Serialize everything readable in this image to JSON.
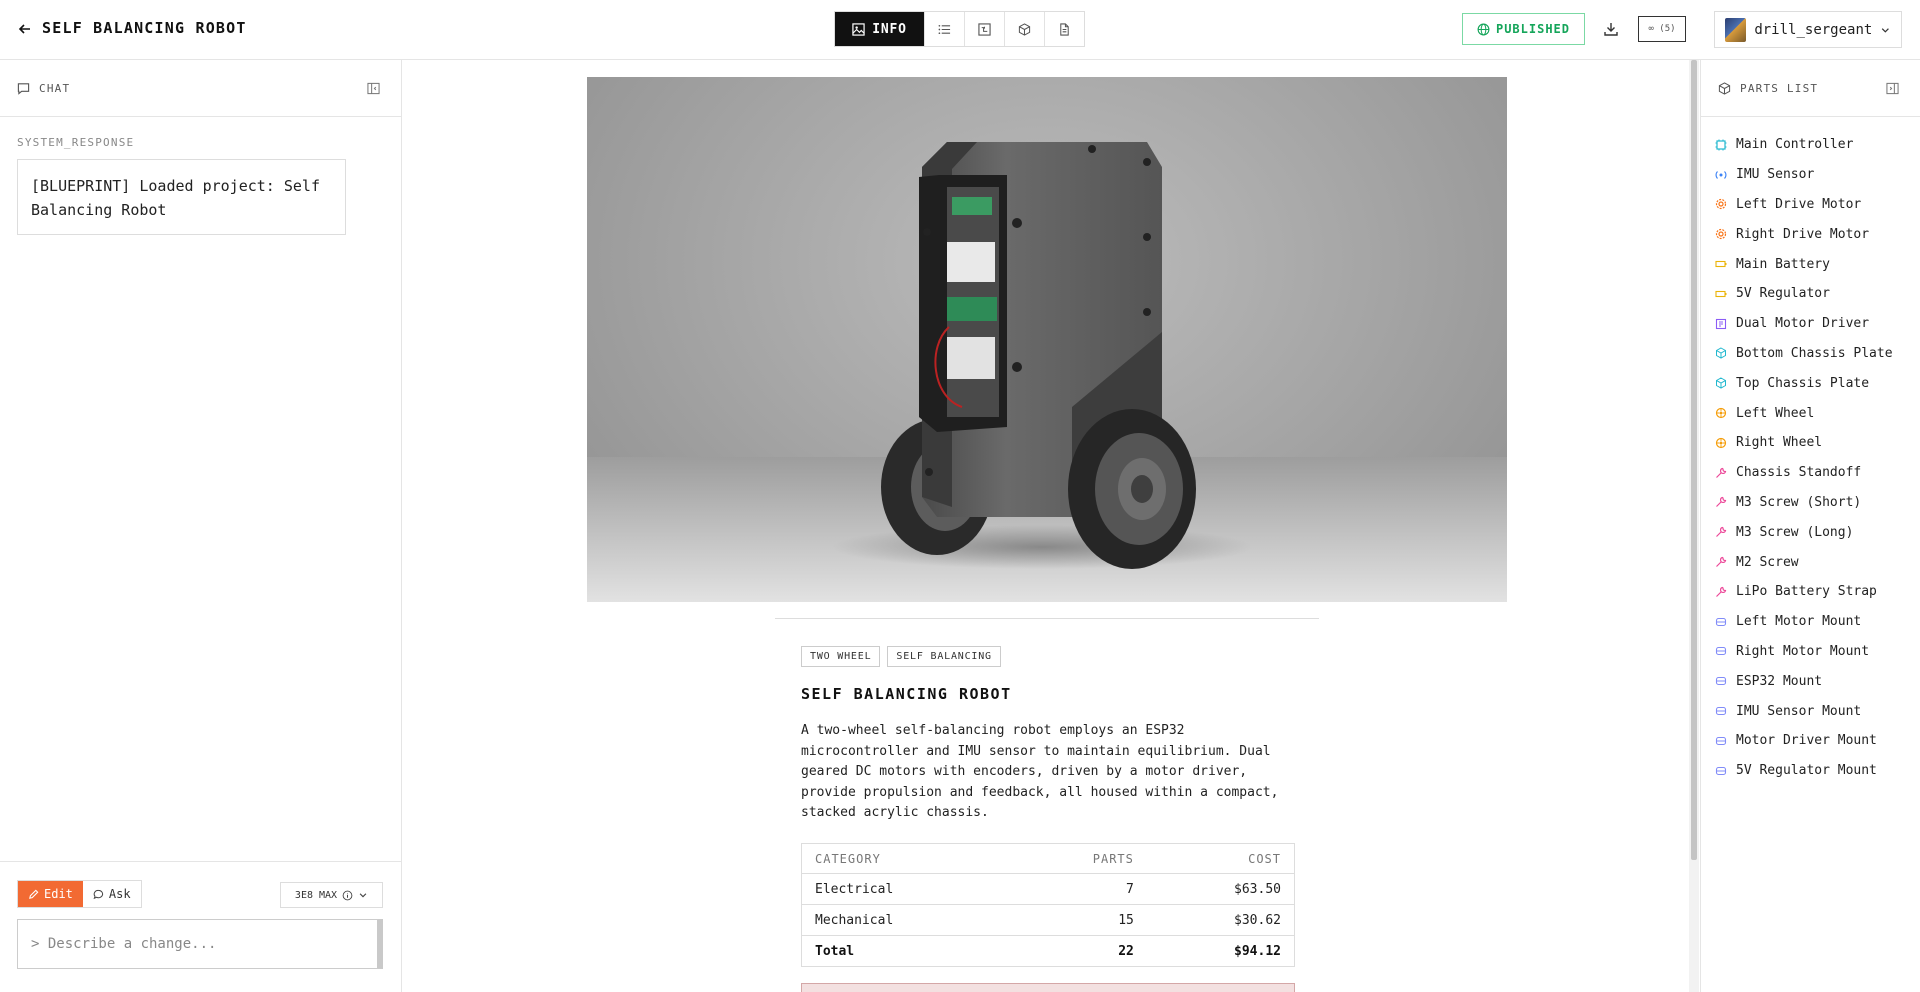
{
  "header": {
    "title": "SELF BALANCING ROBOT",
    "active_tab_label": "INFO",
    "published_label": "PUBLISHED",
    "credits_label": "∞ (5)",
    "username": "drill_sergeant"
  },
  "chat": {
    "title": "CHAT",
    "system_label": "SYSTEM_RESPONSE",
    "system_message": "[BLUEPRINT] Loaded project: Self Balancing Robot",
    "edit_label": "Edit",
    "ask_label": "Ask",
    "model_label": "3E8 MAX",
    "input_placeholder": "> Describe a change..."
  },
  "project": {
    "tags": [
      "TWO WHEEL",
      "SELF BALANCING"
    ],
    "title": "SELF BALANCING ROBOT",
    "description": "A two-wheel self-balancing robot employs an ESP32 microcontroller and IMU sensor to maintain equilibrium. Dual geared DC motors with encoders, driven by a motor driver, provide propulsion and feedback, all housed within a compact, stacked acrylic chassis.",
    "table": {
      "headers": [
        "CATEGORY",
        "PARTS",
        "COST"
      ],
      "rows": [
        {
          "category": "Electrical",
          "parts": "7",
          "cost": "$63.50"
        },
        {
          "category": "Mechanical",
          "parts": "15",
          "cost": "$30.62"
        }
      ],
      "total": {
        "category": "Total",
        "parts": "22",
        "cost": "$94.12"
      }
    }
  },
  "parts": {
    "title": "PARTS LIST",
    "items": [
      {
        "label": "Main Controller",
        "icon": "chip-icon",
        "color": "#22b8cf"
      },
      {
        "label": "IMU Sensor",
        "icon": "radio-icon",
        "color": "#3b82f6"
      },
      {
        "label": "Left Drive Motor",
        "icon": "gear-icon",
        "color": "#f97316"
      },
      {
        "label": "Right Drive Motor",
        "icon": "gear-icon",
        "color": "#f97316"
      },
      {
        "label": "Main Battery",
        "icon": "battery-icon",
        "color": "#eab308"
      },
      {
        "label": "5V Regulator",
        "icon": "battery-icon",
        "color": "#eab308"
      },
      {
        "label": "Dual Motor Driver",
        "icon": "board-icon",
        "color": "#8b5cf6"
      },
      {
        "label": "Bottom Chassis Plate",
        "icon": "box-icon",
        "color": "#22b8cf"
      },
      {
        "label": "Top Chassis Plate",
        "icon": "box-icon",
        "color": "#22b8cf"
      },
      {
        "label": "Left Wheel",
        "icon": "wheel-icon",
        "color": "#f59e0b"
      },
      {
        "label": "Right Wheel",
        "icon": "wheel-icon",
        "color": "#f59e0b"
      },
      {
        "label": "Chassis Standoff",
        "icon": "wrench-icon",
        "color": "#ec4899"
      },
      {
        "label": "M3 Screw (Short)",
        "icon": "wrench-icon",
        "color": "#ec4899"
      },
      {
        "label": "M3 Screw (Long)",
        "icon": "wrench-icon",
        "color": "#ec4899"
      },
      {
        "label": "M2 Screw",
        "icon": "wrench-icon",
        "color": "#ec4899"
      },
      {
        "label": "LiPo Battery Strap",
        "icon": "wrench-icon",
        "color": "#ec4899"
      },
      {
        "label": "Left Motor Mount",
        "icon": "mount-icon",
        "color": "#818cf8"
      },
      {
        "label": "Right Motor Mount",
        "icon": "mount-icon",
        "color": "#818cf8"
      },
      {
        "label": "ESP32 Mount",
        "icon": "mount-icon",
        "color": "#818cf8"
      },
      {
        "label": "IMU Sensor Mount",
        "icon": "mount-icon",
        "color": "#818cf8"
      },
      {
        "label": "Motor Driver Mount",
        "icon": "mount-icon",
        "color": "#818cf8"
      },
      {
        "label": "5V Regulator Mount",
        "icon": "mount-icon",
        "color": "#818cf8"
      }
    ]
  }
}
